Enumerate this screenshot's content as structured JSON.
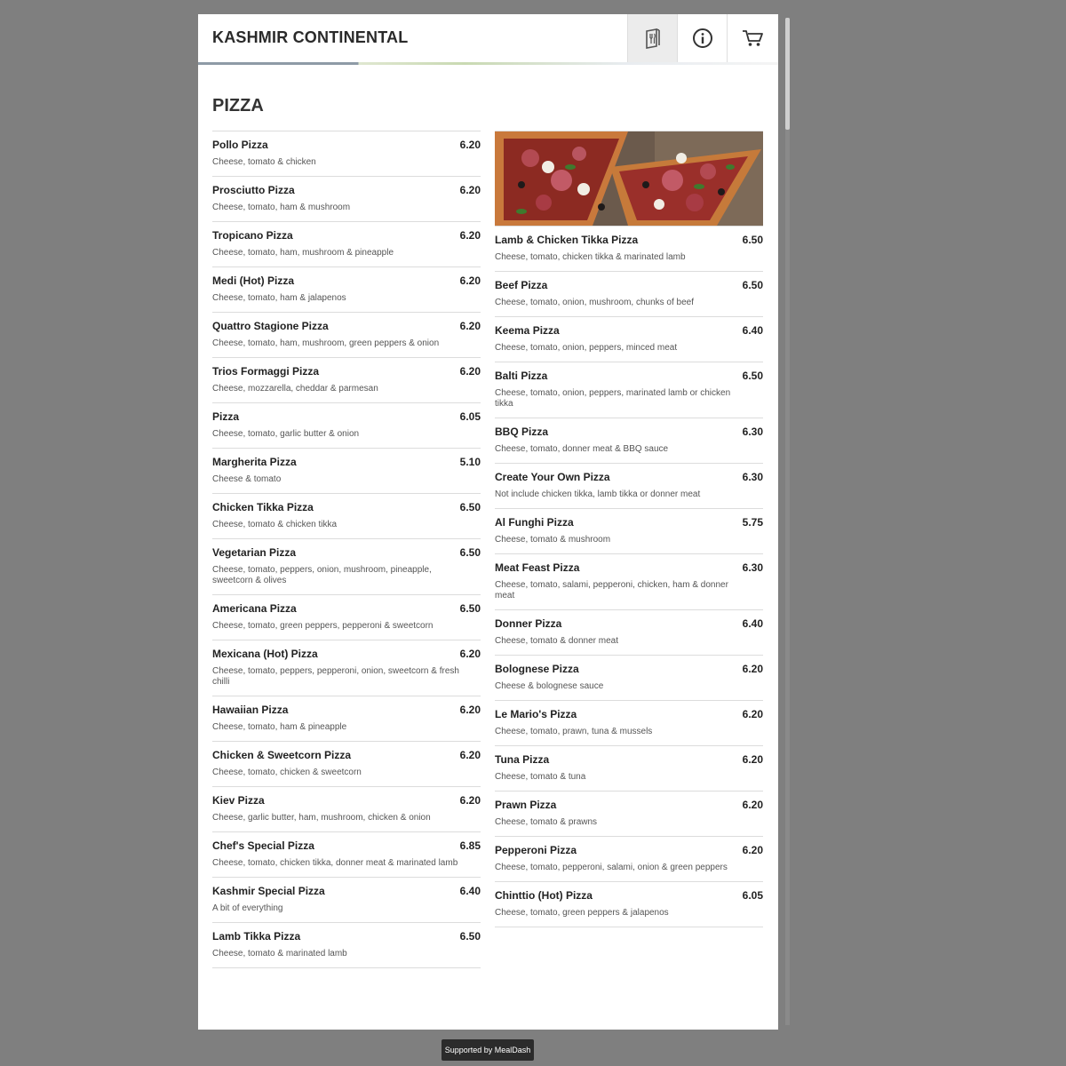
{
  "header": {
    "title": "KASHMIR CONTINENTAL",
    "buttons": [
      {
        "name": "menu-icon"
      },
      {
        "name": "info-icon"
      },
      {
        "name": "cart-icon"
      }
    ]
  },
  "section": {
    "title": "PIZZA"
  },
  "hero_image": {
    "name": "pizza-photo"
  },
  "left_items": [
    {
      "name": "Pollo Pizza",
      "price": "6.20",
      "desc": "Cheese, tomato & chicken"
    },
    {
      "name": "Prosciutto Pizza",
      "price": "6.20",
      "desc": "Cheese, tomato, ham & mushroom"
    },
    {
      "name": "Tropicano Pizza",
      "price": "6.20",
      "desc": "Cheese, tomato, ham, mushroom & pineapple"
    },
    {
      "name": "Medi (Hot) Pizza",
      "price": "6.20",
      "desc": "Cheese, tomato, ham & jalapenos"
    },
    {
      "name": "Quattro Stagione Pizza",
      "price": "6.20",
      "desc": "Cheese, tomato, ham, mushroom, green peppers & onion"
    },
    {
      "name": "Trios Formaggi Pizza",
      "price": "6.20",
      "desc": "Cheese, mozzarella, cheddar & parmesan"
    },
    {
      "name": "Pizza",
      "price": "6.05",
      "desc": "Cheese, tomato, garlic butter & onion"
    },
    {
      "name": "Margherita Pizza",
      "price": "5.10",
      "desc": "Cheese & tomato"
    },
    {
      "name": "Chicken Tikka Pizza",
      "price": "6.50",
      "desc": "Cheese, tomato & chicken tikka"
    },
    {
      "name": "Vegetarian Pizza",
      "price": "6.50",
      "desc": "Cheese, tomato, peppers, onion, mushroom, pineapple, sweetcorn & olives"
    },
    {
      "name": "Americana Pizza",
      "price": "6.50",
      "desc": "Cheese, tomato, green peppers, pepperoni & sweetcorn"
    },
    {
      "name": "Mexicana (Hot) Pizza",
      "price": "6.20",
      "desc": "Cheese, tomato, peppers, pepperoni, onion, sweetcorn & fresh chilli"
    },
    {
      "name": "Hawaiian Pizza",
      "price": "6.20",
      "desc": "Cheese, tomato, ham & pineapple"
    },
    {
      "name": "Chicken & Sweetcorn Pizza",
      "price": "6.20",
      "desc": "Cheese, tomato, chicken & sweetcorn"
    },
    {
      "name": "Kiev Pizza",
      "price": "6.20",
      "desc": "Cheese, garlic butter, ham, mushroom, chicken & onion"
    },
    {
      "name": "Chef's Special Pizza",
      "price": "6.85",
      "desc": "Cheese, tomato, chicken tikka, donner meat & marinated lamb"
    },
    {
      "name": "Kashmir Special Pizza",
      "price": "6.40",
      "desc": "A bit of everything"
    },
    {
      "name": "Lamb Tikka Pizza",
      "price": "6.50",
      "desc": "Cheese, tomato & marinated lamb"
    }
  ],
  "right_items": [
    {
      "name": "Lamb & Chicken Tikka Pizza",
      "price": "6.50",
      "desc": "Cheese, tomato, chicken tikka & marinated lamb"
    },
    {
      "name": "Beef Pizza",
      "price": "6.50",
      "desc": "Cheese, tomato, onion, mushroom, chunks of beef"
    },
    {
      "name": "Keema Pizza",
      "price": "6.40",
      "desc": "Cheese, tomato, onion, peppers, minced meat"
    },
    {
      "name": "Balti Pizza",
      "price": "6.50",
      "desc": "Cheese, tomato, onion, peppers, marinated lamb or chicken tikka"
    },
    {
      "name": "BBQ Pizza",
      "price": "6.30",
      "desc": "Cheese, tomato, donner meat & BBQ sauce"
    },
    {
      "name": "Create Your Own Pizza",
      "price": "6.30",
      "desc": "Not include chicken tikka, lamb tikka or donner meat"
    },
    {
      "name": "Al Funghi Pizza",
      "price": "5.75",
      "desc": "Cheese, tomato & mushroom"
    },
    {
      "name": "Meat Feast Pizza",
      "price": "6.30",
      "desc": "Cheese, tomato, salami, pepperoni, chicken, ham & donner meat"
    },
    {
      "name": "Donner Pizza",
      "price": "6.40",
      "desc": "Cheese, tomato & donner meat"
    },
    {
      "name": "Bolognese Pizza",
      "price": "6.20",
      "desc": "Cheese & bolognese sauce"
    },
    {
      "name": "Le Mario's Pizza",
      "price": "6.20",
      "desc": "Cheese, tomato, prawn, tuna & mussels"
    },
    {
      "name": "Tuna Pizza",
      "price": "6.20",
      "desc": "Cheese, tomato & tuna"
    },
    {
      "name": "Prawn Pizza",
      "price": "6.20",
      "desc": "Cheese, tomato & prawns"
    },
    {
      "name": "Pepperoni Pizza",
      "price": "6.20",
      "desc": "Cheese, tomato, pepperoni, salami, onion & green peppers"
    },
    {
      "name": "Chinttio (Hot) Pizza",
      "price": "6.05",
      "desc": "Cheese, tomato, green peppers & jalapenos"
    }
  ],
  "footer": {
    "label": "Supported by MealDash"
  }
}
